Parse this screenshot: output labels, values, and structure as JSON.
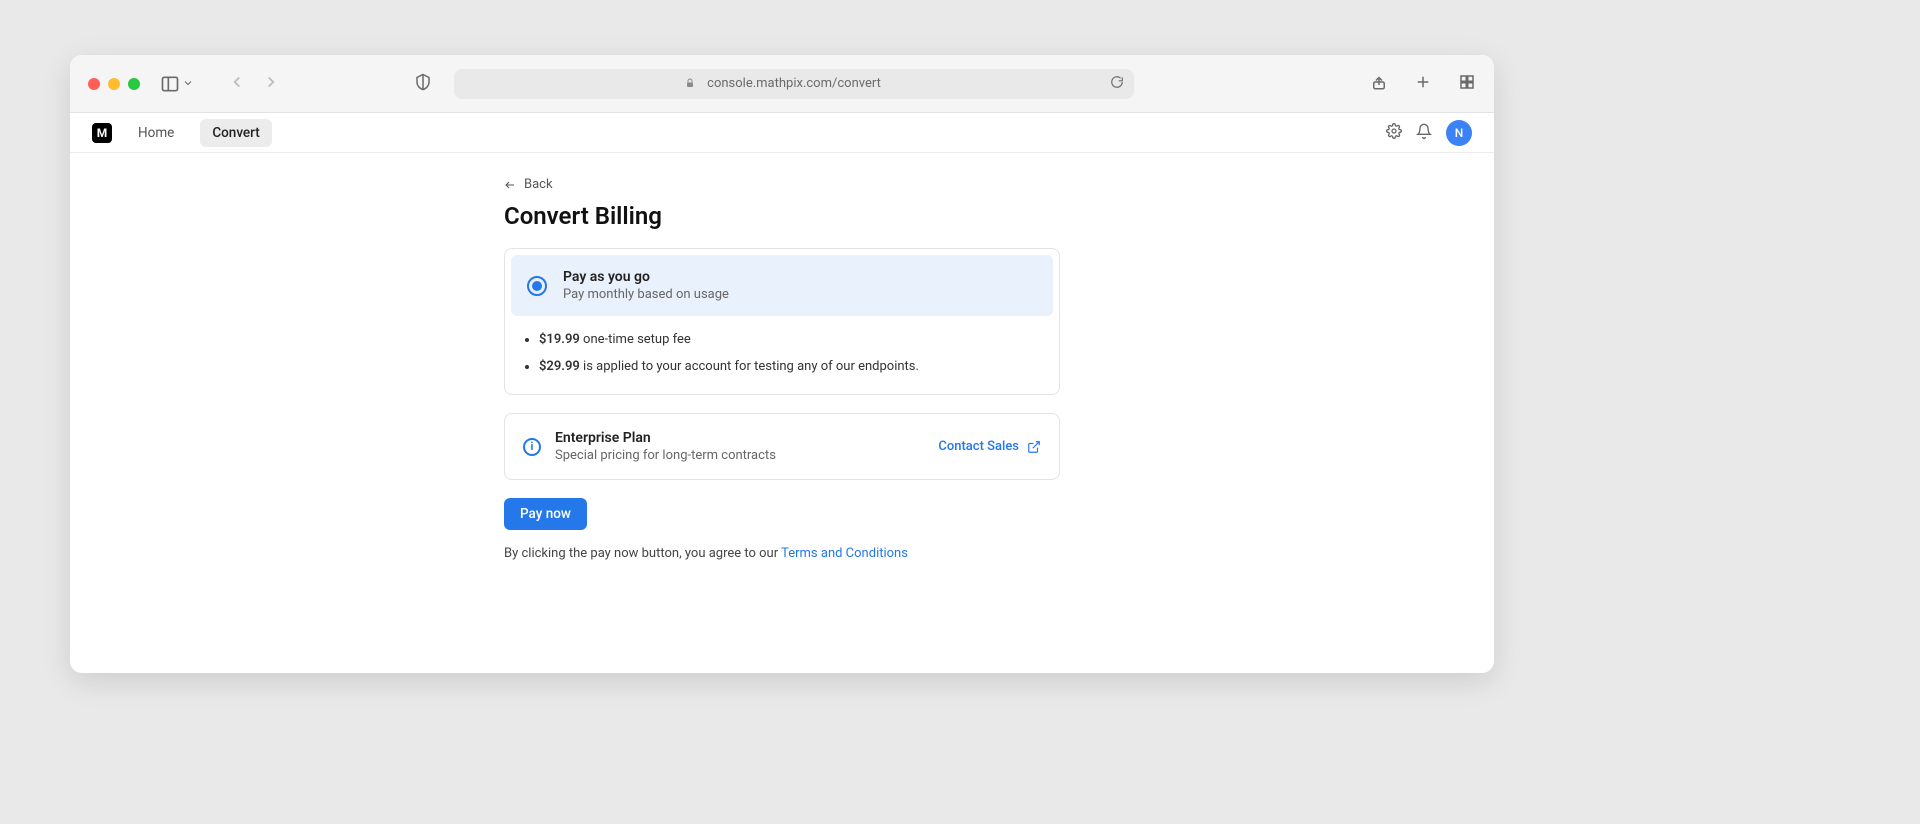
{
  "browser": {
    "url": "console.mathpix.com/convert"
  },
  "nav": {
    "home": "Home",
    "convert": "Convert"
  },
  "avatar": "N",
  "back": "Back",
  "title": "Convert Billing",
  "plan": {
    "name": "Pay as you go",
    "sub": "Pay monthly based on usage",
    "bullet1_price": "$19.99",
    "bullet1_text": " one-time setup fee",
    "bullet2_price": "$29.99",
    "bullet2_text": " is applied to your account for testing any of our endpoints."
  },
  "enterprise": {
    "title": "Enterprise Plan",
    "sub": "Special pricing for long-term contracts",
    "contact": "Contact Sales"
  },
  "pay_button": "Pay now",
  "terms_prefix": "By clicking the pay now button, you agree to our ",
  "terms_link": "Terms and Conditions"
}
